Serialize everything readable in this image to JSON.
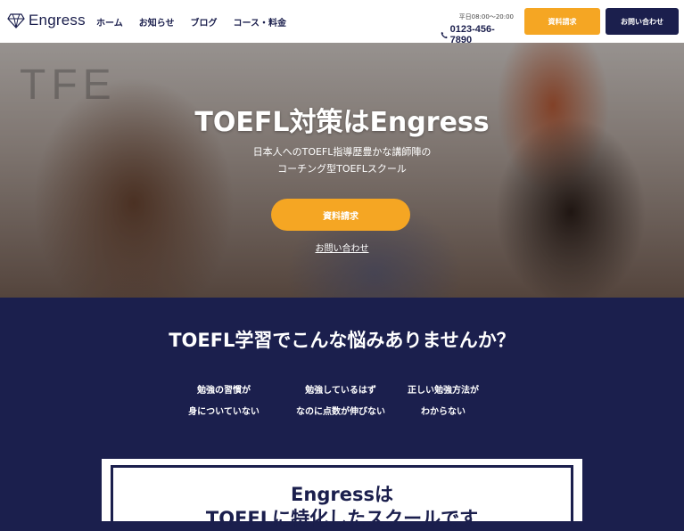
{
  "header": {
    "logo_text": "Engress",
    "nav": [
      "ホーム",
      "お知らせ",
      "ブログ",
      "コース・料金"
    ],
    "hours": "平日08:00〜20:00",
    "phone": "0123-456-7890",
    "doc_button": "資料請求",
    "contact_button": "お問い合わせ"
  },
  "hero": {
    "title": "TOEFL対策はEngress",
    "subtitle_line1": "日本人へのTOEFL指導歴豊かな講師陣の",
    "subtitle_line2": "コーチング型TOEFLスクール",
    "cta_button": "資料請求",
    "contact_link": "お問い合わせ"
  },
  "worries": {
    "title": "TOEFL学習でこんな悩みありませんか？",
    "items": [
      {
        "line1": "勉強の習慣が",
        "line2": "身についていない"
      },
      {
        "line1": "勉強しているはず",
        "line2": "なのに点数が伸びない"
      },
      {
        "line1": "正しい勉強方法が",
        "line2": "わからない"
      }
    ]
  },
  "feature": {
    "line1": "Engressは",
    "line2": "TOEFLに特化したスクールです"
  },
  "colors": {
    "navy": "#1b1f4d",
    "orange": "#f5a623"
  }
}
